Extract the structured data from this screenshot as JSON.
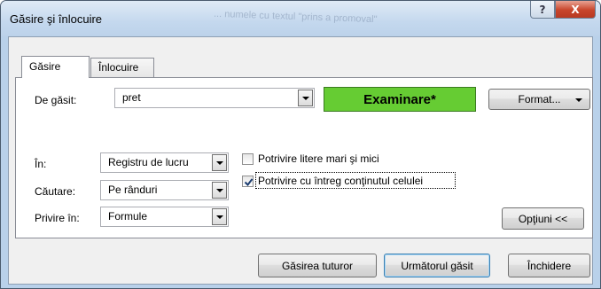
{
  "window": {
    "title": "Găsire şi înlocuire",
    "background_text": "... numele cu textul \"prins a promoval\""
  },
  "tabs": [
    {
      "label": "Găsire",
      "active": true
    },
    {
      "label": "Înlocuire",
      "active": false
    }
  ],
  "find": {
    "label": "De găsit:",
    "value": "pret",
    "preview_label": "Examinare*",
    "preview_color": "#66cc33",
    "format_label": "Format..."
  },
  "options": {
    "within_label": "În:",
    "within_value": "Registru de lucru",
    "search_label": "Căutare:",
    "search_value": "Pe rânduri",
    "lookin_label": "Privire în:",
    "lookin_value": "Formule",
    "match_case_label": "Potrivire litere mari şi mici",
    "match_case_checked": false,
    "match_entire_label": "Potrivire cu întreg conţinutul celulei",
    "match_entire_checked": true,
    "options_button": "Opţiuni <<"
  },
  "buttons": {
    "find_all": "Găsirea tuturor",
    "find_next": "Următorul găsit",
    "close": "Închidere"
  },
  "titlebar_buttons": {
    "help": "?",
    "close": "X"
  }
}
